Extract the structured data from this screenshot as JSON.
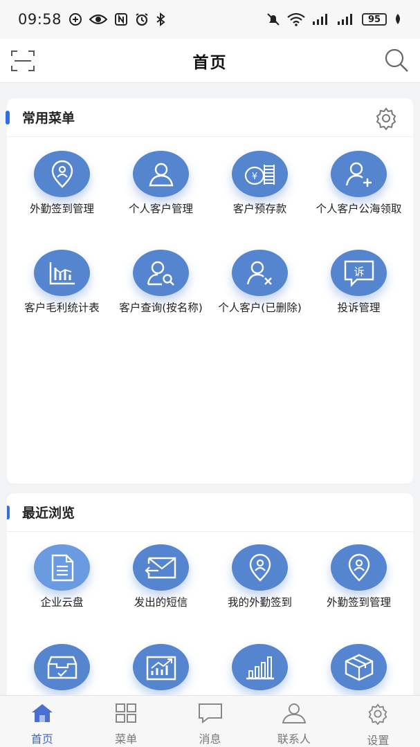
{
  "status_bar": {
    "time": "09:58",
    "battery": "95",
    "left_icons": [
      "data-saver-icon",
      "eye-icon",
      "nfc-icon",
      "alarm-icon",
      "bluetooth-icon"
    ],
    "right_icons": [
      "mute-icon",
      "wifi-icon",
      "signal-icon",
      "signal-icon",
      "battery-icon",
      "leaf-icon"
    ]
  },
  "header": {
    "title": "首页",
    "left_icon": "scan-icon",
    "right_icon": "search-icon"
  },
  "favorites": {
    "title": "常用菜单",
    "settings_icon": "gear-icon",
    "items": [
      {
        "label": "外勤签到管理",
        "icon": "location-pin-icon"
      },
      {
        "label": "个人客户管理",
        "icon": "user-icon"
      },
      {
        "label": "客户预存款",
        "icon": "coins-icon"
      },
      {
        "label": "个人客户公海领取",
        "icon": "user-add-icon"
      },
      {
        "label": "客户毛利统计表",
        "icon": "bar-chart-icon"
      },
      {
        "label": "客户查询(按名称)",
        "icon": "user-search-icon"
      },
      {
        "label": "个人客户(已删除)",
        "icon": "user-remove-icon"
      },
      {
        "label": "投诉管理",
        "icon": "complaint-icon"
      }
    ]
  },
  "recent": {
    "title": "最近浏览",
    "items": [
      {
        "label": "企业云盘",
        "icon": "document-icon"
      },
      {
        "label": "发出的短信",
        "icon": "mail-out-icon"
      },
      {
        "label": "我的外勤签到",
        "icon": "location-pin-icon"
      },
      {
        "label": "外勤签到管理",
        "icon": "location-pin-icon"
      },
      {
        "label": "",
        "icon": "inbox-check-icon"
      },
      {
        "label": "",
        "icon": "trend-chart-icon"
      },
      {
        "label": "",
        "icon": "bar-chart-icon"
      },
      {
        "label": "",
        "icon": "package-icon"
      }
    ]
  },
  "tabbar": {
    "items": [
      {
        "label": "首页",
        "icon": "home-icon",
        "active": true
      },
      {
        "label": "菜单",
        "icon": "grid-icon",
        "active": false
      },
      {
        "label": "消息",
        "icon": "message-icon",
        "active": false
      },
      {
        "label": "联系人",
        "icon": "contact-icon",
        "active": false
      },
      {
        "label": "设置",
        "icon": "gear-icon",
        "active": false
      }
    ]
  },
  "colors": {
    "accent": "#2f6fe0",
    "icon_circle": "#5585cf",
    "tab_active": "#3f66c8",
    "background": "#f2f3f5"
  }
}
